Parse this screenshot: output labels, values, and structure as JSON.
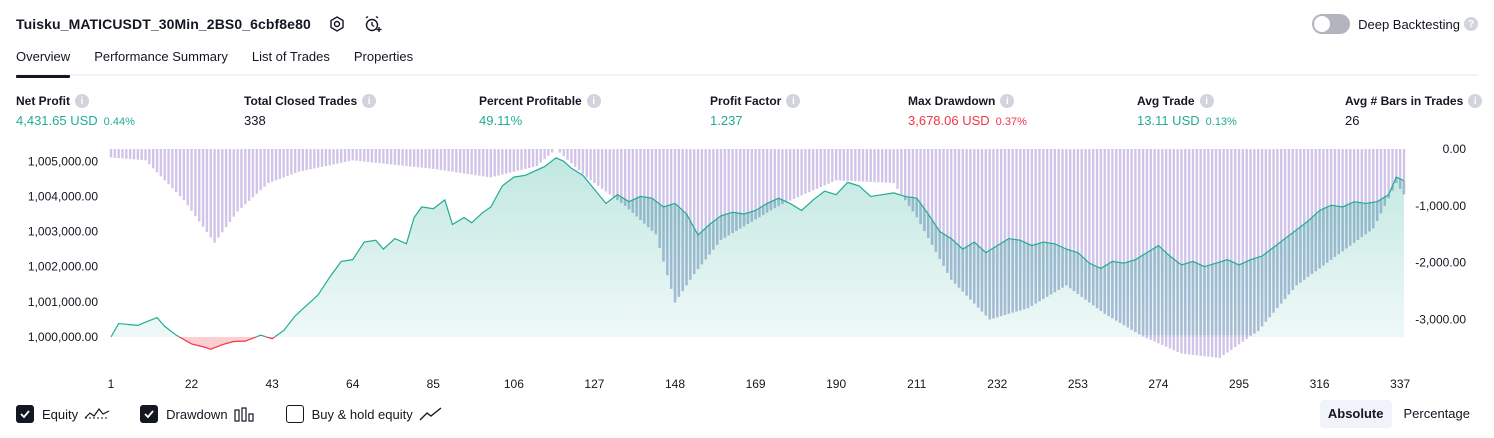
{
  "header": {
    "title": "Tuisku_MATICUSDT_30Min_2BS0_6cbf8e80",
    "icons": [
      "settings-icon",
      "add-alert-icon"
    ],
    "deep_backtesting_label": "Deep Backtesting",
    "deep_backtesting_on": false
  },
  "tabs": [
    {
      "label": "Overview",
      "active": true
    },
    {
      "label": "Performance Summary",
      "active": false
    },
    {
      "label": "List of Trades",
      "active": false
    },
    {
      "label": "Properties",
      "active": false
    }
  ],
  "metrics": [
    {
      "label": "Net Profit",
      "value": "4,431.65 USD",
      "pct": "0.44%",
      "color": "#22ab94"
    },
    {
      "label": "Total Closed Trades",
      "value": "338",
      "pct": "",
      "color": "#131722"
    },
    {
      "label": "Percent Profitable",
      "value": "49.11%",
      "pct": "",
      "color": "#22ab94"
    },
    {
      "label": "Profit Factor",
      "value": "1.237",
      "pct": "",
      "color": "#22ab94"
    },
    {
      "label": "Max Drawdown",
      "value": "3,678.06 USD",
      "pct": "0.37%",
      "color": "#f23645"
    },
    {
      "label": "Avg Trade",
      "value": "13.11 USD",
      "pct": "0.13%",
      "color": "#22ab94"
    },
    {
      "label": "Avg # Bars in Trades",
      "value": "26",
      "pct": "",
      "color": "#131722"
    }
  ],
  "chart_data": {
    "type": "area",
    "x_ticks": [
      "1",
      "22",
      "43",
      "64",
      "85",
      "106",
      "127",
      "148",
      "169",
      "190",
      "211",
      "232",
      "253",
      "274",
      "295",
      "316",
      "337"
    ],
    "xlim": [
      1,
      338
    ],
    "y_left_ticks": [
      "1,005,000.00",
      "1,004,000.00",
      "1,003,000.00",
      "1,002,000.00",
      "1,001,000.00",
      "1,000,000.00"
    ],
    "y_left_values": [
      1005000,
      1004000,
      1003000,
      1002000,
      1001000,
      1000000
    ],
    "y_left_range": [
      999400,
      1005350
    ],
    "y_right_ticks": [
      "0.00",
      "-1,000.00",
      "-2,000.00",
      "-3,000.00"
    ],
    "y_right_values": [
      0,
      -1000,
      -2000,
      -3000
    ],
    "y_right_range": [
      -3678.06,
      0
    ],
    "series": [
      {
        "name": "Equity",
        "type": "area",
        "baseline": 1000000,
        "color_above": "#22ab94",
        "color_below": "#f23645",
        "points": [
          [
            1,
            1000000
          ],
          [
            3,
            1000380
          ],
          [
            8,
            1000330
          ],
          [
            10,
            1000420
          ],
          [
            13,
            1000550
          ],
          [
            15,
            1000300
          ],
          [
            18,
            1000050
          ],
          [
            22,
            999800
          ],
          [
            25,
            999720
          ],
          [
            27,
            999650
          ],
          [
            30,
            999780
          ],
          [
            33,
            999870
          ],
          [
            36,
            999880
          ],
          [
            40,
            1000050
          ],
          [
            43,
            999950
          ],
          [
            46,
            1000180
          ],
          [
            49,
            1000600
          ],
          [
            52,
            1000900
          ],
          [
            55,
            1001200
          ],
          [
            58,
            1001700
          ],
          [
            61,
            1002150
          ],
          [
            64,
            1002200
          ],
          [
            67,
            1002700
          ],
          [
            70,
            1002750
          ],
          [
            72,
            1002500
          ],
          [
            75,
            1002800
          ],
          [
            78,
            1002650
          ],
          [
            80,
            1003400
          ],
          [
            82,
            1003700
          ],
          [
            85,
            1003650
          ],
          [
            88,
            1003900
          ],
          [
            90,
            1003200
          ],
          [
            93,
            1003400
          ],
          [
            95,
            1003250
          ],
          [
            98,
            1003550
          ],
          [
            100,
            1003700
          ],
          [
            103,
            1004300
          ],
          [
            106,
            1004550
          ],
          [
            109,
            1004600
          ],
          [
            112,
            1004750
          ],
          [
            114,
            1004850
          ],
          [
            117,
            1005100
          ],
          [
            119,
            1005000
          ],
          [
            121,
            1004800
          ],
          [
            124,
            1004600
          ],
          [
            127,
            1004200
          ],
          [
            130,
            1003800
          ],
          [
            133,
            1004050
          ],
          [
            136,
            1003850
          ],
          [
            139,
            1004000
          ],
          [
            142,
            1003950
          ],
          [
            145,
            1003700
          ],
          [
            148,
            1003800
          ],
          [
            151,
            1003500
          ],
          [
            154,
            1002900
          ],
          [
            157,
            1003200
          ],
          [
            160,
            1003450
          ],
          [
            163,
            1003550
          ],
          [
            166,
            1003500
          ],
          [
            169,
            1003600
          ],
          [
            172,
            1003800
          ],
          [
            175,
            1003950
          ],
          [
            178,
            1003800
          ],
          [
            181,
            1003600
          ],
          [
            184,
            1003900
          ],
          [
            187,
            1004150
          ],
          [
            190,
            1004050
          ],
          [
            193,
            1004400
          ],
          [
            196,
            1004300
          ],
          [
            199,
            1004000
          ],
          [
            202,
            1004050
          ],
          [
            205,
            1004100
          ],
          [
            208,
            1004000
          ],
          [
            211,
            1003950
          ],
          [
            214,
            1003500
          ],
          [
            217,
            1003000
          ],
          [
            220,
            1002800
          ],
          [
            223,
            1002500
          ],
          [
            226,
            1002700
          ],
          [
            229,
            1002400
          ],
          [
            232,
            1002600
          ],
          [
            235,
            1002800
          ],
          [
            238,
            1002750
          ],
          [
            241,
            1002600
          ],
          [
            244,
            1002700
          ],
          [
            247,
            1002650
          ],
          [
            250,
            1002500
          ],
          [
            253,
            1002400
          ],
          [
            256,
            1002100
          ],
          [
            259,
            1001950
          ],
          [
            262,
            1002150
          ],
          [
            265,
            1002100
          ],
          [
            268,
            1002200
          ],
          [
            271,
            1002400
          ],
          [
            274,
            1002600
          ],
          [
            277,
            1002300
          ],
          [
            280,
            1002050
          ],
          [
            283,
            1002150
          ],
          [
            286,
            1002000
          ],
          [
            289,
            1002100
          ],
          [
            292,
            1002200
          ],
          [
            295,
            1002050
          ],
          [
            298,
            1002200
          ],
          [
            301,
            1002300
          ],
          [
            304,
            1002550
          ],
          [
            307,
            1002800
          ],
          [
            310,
            1003050
          ],
          [
            313,
            1003300
          ],
          [
            316,
            1003600
          ],
          [
            319,
            1003750
          ],
          [
            322,
            1003700
          ],
          [
            325,
            1003850
          ],
          [
            328,
            1003800
          ],
          [
            331,
            1003850
          ],
          [
            334,
            1004050
          ],
          [
            336,
            1004550
          ],
          [
            338,
            1004450
          ]
        ]
      },
      {
        "name": "Drawdown",
        "type": "bar",
        "color": "#d1c4e9",
        "color_overlap": "#b4bddb",
        "points": [
          [
            1,
            -150
          ],
          [
            10,
            -200
          ],
          [
            20,
            -900
          ],
          [
            28,
            -1650
          ],
          [
            34,
            -1100
          ],
          [
            42,
            -600
          ],
          [
            50,
            -400
          ],
          [
            64,
            -200
          ],
          [
            85,
            -350
          ],
          [
            100,
            -500
          ],
          [
            112,
            -300
          ],
          [
            117,
            0
          ],
          [
            125,
            -500
          ],
          [
            135,
            -1000
          ],
          [
            143,
            -1500
          ],
          [
            148,
            -2700
          ],
          [
            153,
            -2200
          ],
          [
            160,
            -1600
          ],
          [
            175,
            -1000
          ],
          [
            190,
            -550
          ],
          [
            205,
            -600
          ],
          [
            211,
            -1200
          ],
          [
            220,
            -2300
          ],
          [
            230,
            -3000
          ],
          [
            240,
            -2800
          ],
          [
            250,
            -2400
          ],
          [
            260,
            -2900
          ],
          [
            270,
            -3300
          ],
          [
            280,
            -3600
          ],
          [
            290,
            -3678.06
          ],
          [
            300,
            -3200
          ],
          [
            310,
            -2400
          ],
          [
            320,
            -1900
          ],
          [
            330,
            -1400
          ],
          [
            336,
            -600
          ],
          [
            338,
            -800
          ]
        ]
      }
    ],
    "legend": [
      "Equity",
      "Drawdown",
      "Buy & hold equity"
    ]
  },
  "legend": {
    "equity_label": "Equity",
    "equity_checked": true,
    "drawdown_label": "Drawdown",
    "drawdown_checked": true,
    "buyhold_label": "Buy & hold equity",
    "buyhold_checked": false
  },
  "mode": {
    "absolute_label": "Absolute",
    "percentage_label": "Percentage",
    "active": "Absolute"
  }
}
